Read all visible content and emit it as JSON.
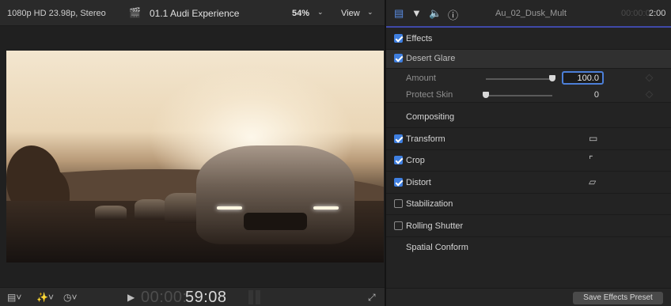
{
  "viewer": {
    "format": "1080p HD 23.98p, Stereo",
    "project": "01.1 Audi Experience",
    "zoom": "54%",
    "view_menu": "View"
  },
  "transport": {
    "timecode_dim": "00:00:",
    "timecode": "59:08"
  },
  "inspector": {
    "clip_name": "Au_02_Dusk_Mult",
    "clip_duration_dim": "00:00:0",
    "clip_duration": "2:00",
    "effects_label": "Effects",
    "effect_name": "Desert Glare",
    "params": [
      {
        "label": "Amount",
        "value": "100.0",
        "level": 1.0
      },
      {
        "label": "Protect Skin",
        "value": "0",
        "level": 0.0
      }
    ],
    "compositing_label": "Compositing",
    "sections": [
      {
        "label": "Transform",
        "checked": true,
        "icon": "transform-icon"
      },
      {
        "label": "Crop",
        "checked": true,
        "icon": "crop-icon"
      },
      {
        "label": "Distort",
        "checked": true,
        "icon": "distort-icon"
      },
      {
        "label": "Stabilization",
        "checked": false
      },
      {
        "label": "Rolling Shutter",
        "checked": false
      }
    ],
    "spatial_conform_label": "Spatial Conform",
    "save_preset_label": "Save Effects Preset"
  }
}
